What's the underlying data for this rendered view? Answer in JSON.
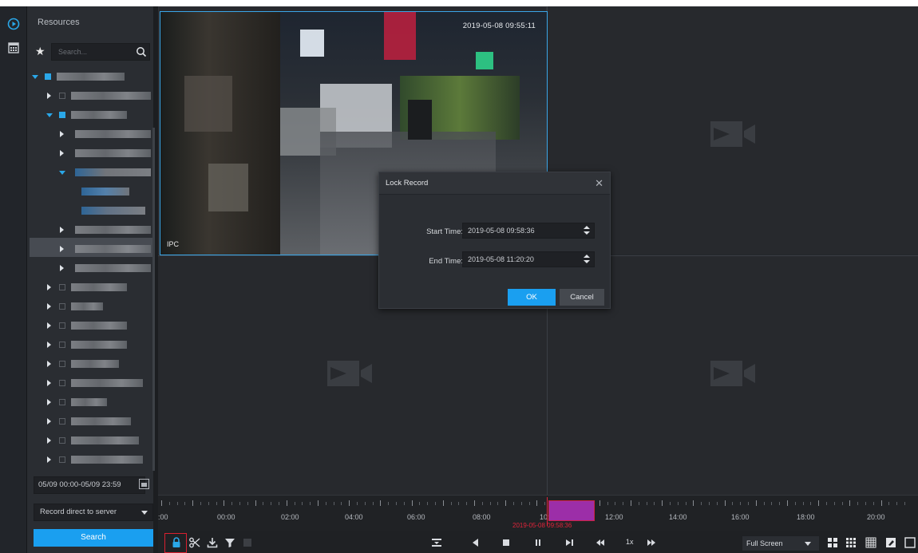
{
  "resources_panel": {
    "title": "Resources",
    "search_placeholder": "Search..."
  },
  "search_form": {
    "time_range": "05/09 00:00-05/09 23:59",
    "record_source": "Record direct to server",
    "search_label": "Search"
  },
  "video": {
    "timestamp": "2019-05-08 09:55:11",
    "channel_label": "IPC"
  },
  "lock_dialog": {
    "title": "Lock Record",
    "start_label": "Start Time:",
    "start_value": "2019-05-08 09:58:36",
    "end_label": "End Time:",
    "end_value": "2019-05-08 11:20:20",
    "ok_label": "OK",
    "cancel_label": "Cancel"
  },
  "timeline": {
    "labels": [
      ":00",
      "00:00",
      "02:00",
      "04:00",
      "06:00",
      "08:00",
      "10:00",
      "12:00",
      "14:00",
      "16:00",
      "18:00",
      "20:00"
    ],
    "cursor_time": "2019-05-08 09:58:36",
    "record_color": "#9c2ea8",
    "cursor_color": "#e0243a"
  },
  "toolbar": {
    "speed": "1x",
    "window_mode": "Full Screen"
  },
  "colors": {
    "accent": "#1a9ff0",
    "highlight": "#d8202f"
  }
}
